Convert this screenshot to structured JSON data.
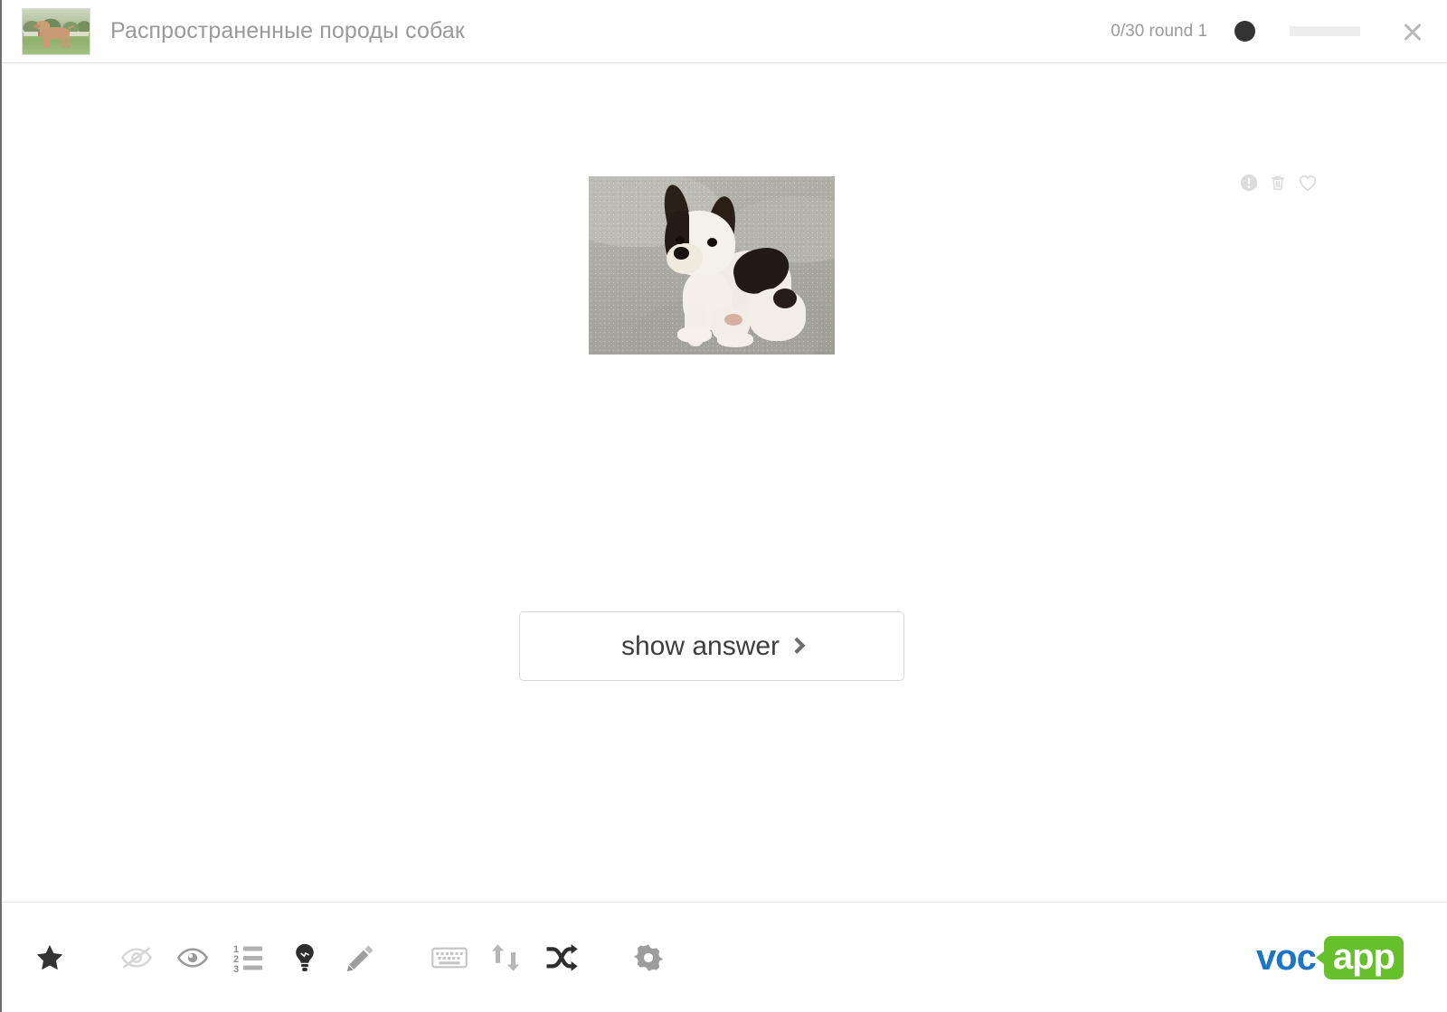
{
  "header": {
    "deck_thumbnail_alt": "deck-cover-dog-photo",
    "deck_title": "Распространенные породы собак",
    "score": "0/30 round 1",
    "round_indicator_color": "#333333",
    "progress_percent": 0,
    "progress_track_color": "#ededed",
    "close_label": "×"
  },
  "card": {
    "image_alt": "french-bulldog-puppy-photo",
    "actions": [
      {
        "name": "report-icon",
        "label": "report mistake"
      },
      {
        "name": "trash-icon",
        "label": "delete card"
      },
      {
        "name": "heart-icon",
        "label": "add to favourites"
      }
    ],
    "show_answer_label": "show answer",
    "chevron": "›"
  },
  "footer": {
    "tools": [
      {
        "name": "star-icon",
        "label": "star",
        "state": "active"
      },
      {
        "name": "eye-slash-icon",
        "label": "hide answer",
        "state": "muted"
      },
      {
        "name": "eye-icon",
        "label": "show answer always",
        "state": "inactive"
      },
      {
        "name": "numbered-list-icon",
        "label": "list of cards",
        "state": "inactive"
      },
      {
        "name": "lightbulb-icon",
        "label": "hint",
        "state": "active"
      },
      {
        "name": "pencil-icon",
        "label": "edit card",
        "state": "inactive"
      },
      {
        "name": "keyboard-icon",
        "label": "typing mode",
        "state": "muted"
      },
      {
        "name": "repeat-icon",
        "label": "repeat cards",
        "state": "inactive"
      },
      {
        "name": "shuffle-icon",
        "label": "shuffle cards",
        "state": "active"
      },
      {
        "name": "gear-icon",
        "label": "settings",
        "state": "inactive"
      }
    ],
    "brand": {
      "part_one": "voc",
      "part_two": "app",
      "color_one": "#1f74c4",
      "color_two": "#66c02c"
    }
  }
}
